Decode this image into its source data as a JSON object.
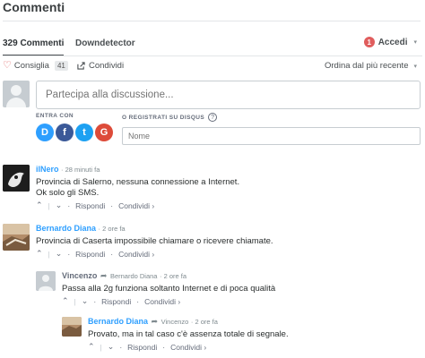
{
  "header": {
    "title": "Commenti"
  },
  "tabs": [
    {
      "label": "329 Commenti"
    },
    {
      "label": "Downdetector"
    }
  ],
  "login": {
    "badge": "1",
    "label": "Accedi"
  },
  "actions": {
    "recommend": "Consiglia",
    "recommend_count": "41",
    "share": "Condividi",
    "sort": "Ordina dal più recente"
  },
  "composer": {
    "placeholder": "Partecipa alla discussione...",
    "login_with": "ENTRA CON",
    "or_register": "O REGISTRATI SU DISQUS",
    "help": "?",
    "name_placeholder": "Nome",
    "social": [
      {
        "letter": "D",
        "color": "#2e9fff"
      },
      {
        "letter": "f",
        "color": "#3b5998"
      },
      {
        "letter": "t",
        "color": "#1da1f2"
      },
      {
        "letter": "G",
        "color": "#dd4b39"
      }
    ]
  },
  "comments": [
    {
      "author": "ilNero",
      "time": "28 minuti fa",
      "lines": [
        "Provincia di Salerno, nessuna connessione a Internet.",
        "Ok solo gli SMS."
      ],
      "reply": "Rispondi",
      "share": "Condividi ›"
    },
    {
      "author": "Bernardo Diana",
      "time": "2 ore fa",
      "lines": [
        "Provincia di Caserta impossibile chiamare o ricevere chiamate."
      ],
      "reply": "Rispondi",
      "share": "Condividi ›"
    },
    {
      "author": "Vincenzo",
      "reply_to": "Bernardo Diana",
      "time": "2 ore fa",
      "lines": [
        "Passa alla 2g funziona soltanto Internet e di poca qualità"
      ],
      "reply": "Rispondi",
      "share": "Condividi ›"
    },
    {
      "author": "Bernardo Diana",
      "reply_to": "Vincenzo",
      "time": "2 ore fa",
      "lines": [
        "Provato, ma in tal caso c'è assenza totale di segnale."
      ],
      "reply": "Rispondi",
      "share": "Condividi ›"
    }
  ],
  "colors": {
    "accent": "#2e9fff",
    "badge": "#e05d5d"
  }
}
